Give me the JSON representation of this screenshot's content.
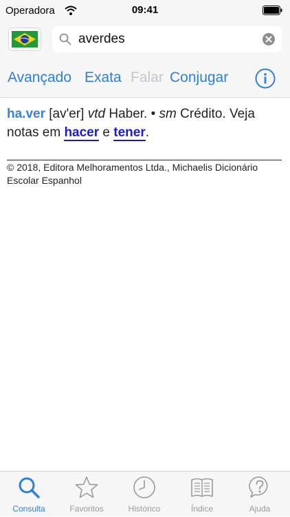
{
  "status": {
    "carrier": "Operadora",
    "time": "09:41"
  },
  "search": {
    "query": "averdes"
  },
  "toolbar": {
    "advanced": "Avançado",
    "exact": "Exata",
    "speak": "Falar",
    "conjugate": "Conjugar"
  },
  "entry": {
    "headword": "ha.ver",
    "pronunciation": "[av'er]",
    "pos1": "vtd",
    "def1": "Haber. •",
    "pos2": "sm",
    "def2": "Crédito. Veja notas em",
    "link1": "hacer",
    "conj": "e",
    "link2": "tener",
    "end": "."
  },
  "copyright": "© 2018, Editora Melhoramentos Ltda., Michaelis Dicionário Escolar Espanhol",
  "tabs": [
    {
      "label": "Consulta",
      "icon": "search-icon",
      "active": true
    },
    {
      "label": "Favoritos",
      "icon": "star-icon",
      "active": false
    },
    {
      "label": "Histórico",
      "icon": "clock-icon",
      "active": false
    },
    {
      "label": "Índice",
      "icon": "book-icon",
      "active": false
    },
    {
      "label": "Ajuda",
      "icon": "help-icon",
      "active": false
    }
  ],
  "colors": {
    "accent": "#2f7fd6",
    "link": "#1c1cc8",
    "headword": "#3a82cf",
    "disabled": "#c3c6cc"
  }
}
